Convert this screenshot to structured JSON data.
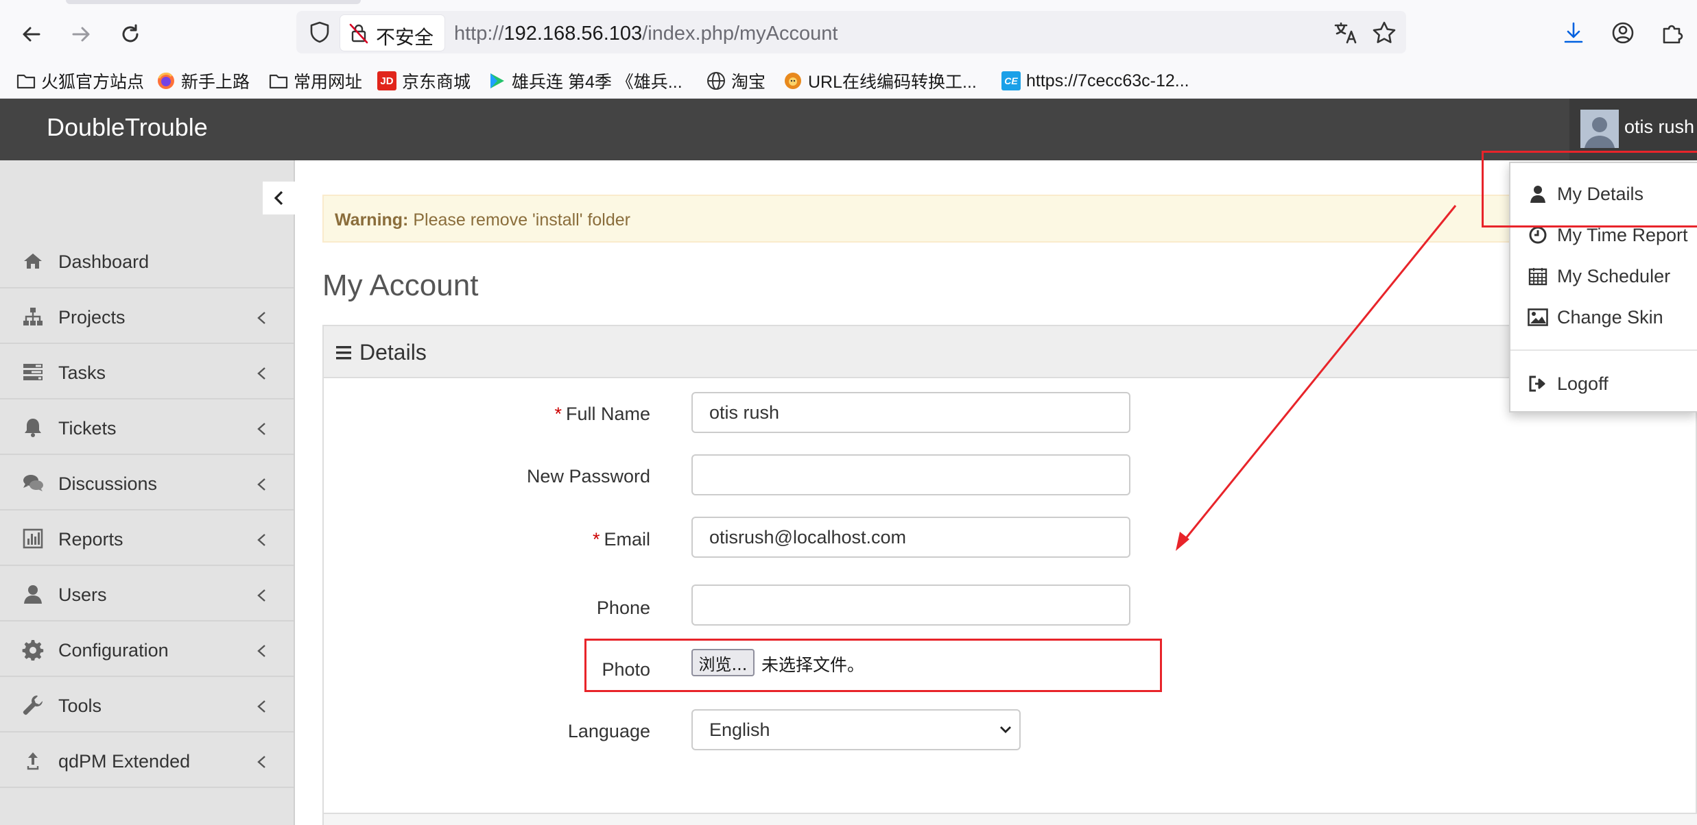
{
  "browser": {
    "security_label": "不安全",
    "url_scheme": "http://",
    "url_host": "192.168.56.103",
    "url_path": "/index.php/myAccount",
    "bookmarks": [
      {
        "label": "火狐官方站点",
        "icon": "folder-icon"
      },
      {
        "label": "新手上路",
        "icon": "firefox-icon"
      },
      {
        "label": "常用网址",
        "icon": "folder-icon"
      },
      {
        "label": "京东商城",
        "icon": "jd-icon"
      },
      {
        "label": "雄兵连 第4季 《雄兵...",
        "icon": "video-icon"
      },
      {
        "label": "淘宝",
        "icon": "globe-icon"
      },
      {
        "label": "URL在线编码转换工...",
        "icon": "lion-icon"
      },
      {
        "label": "https://7cecc63c-12...",
        "icon": "ce-icon"
      }
    ],
    "jd_icon_text": "JD",
    "ce_icon_text": "CE"
  },
  "app": {
    "brand": "DoubleTrouble",
    "user_name": "otis rush"
  },
  "sidebar": {
    "items": [
      {
        "label": "Dashboard",
        "icon": "home-icon",
        "has_submenu": false
      },
      {
        "label": "Projects",
        "icon": "sitemap-icon",
        "has_submenu": true
      },
      {
        "label": "Tasks",
        "icon": "tasks-icon",
        "has_submenu": true
      },
      {
        "label": "Tickets",
        "icon": "bell-icon",
        "has_submenu": true
      },
      {
        "label": "Discussions",
        "icon": "comments-icon",
        "has_submenu": true
      },
      {
        "label": "Reports",
        "icon": "bar-chart-icon",
        "has_submenu": true
      },
      {
        "label": "Users",
        "icon": "user-icon",
        "has_submenu": true
      },
      {
        "label": "Configuration",
        "icon": "gear-icon",
        "has_submenu": true
      },
      {
        "label": "Tools",
        "icon": "wrench-icon",
        "has_submenu": true
      },
      {
        "label": "qdPM Extended",
        "icon": "upload-icon",
        "has_submenu": true
      }
    ]
  },
  "main": {
    "warning_strong": "Warning:",
    "warning_text": "Please remove 'install' folder",
    "page_title": "My Account",
    "panel_title": "Details",
    "form": {
      "full_name_label": "Full Name",
      "full_name_value": "otis rush",
      "new_password_label": "New Password",
      "new_password_value": "",
      "email_label": "Email",
      "email_value": "otisrush@localhost.com",
      "phone_label": "Phone",
      "phone_value": "",
      "photo_label": "Photo",
      "photo_browse_label": "浏览...",
      "photo_status": "未选择文件。",
      "language_label": "Language",
      "language_value": "English",
      "required_mark": "*"
    }
  },
  "user_dropdown": {
    "items": [
      {
        "label": "My Details",
        "icon": "user-icon"
      },
      {
        "label": "My Time Report",
        "icon": "clock-icon"
      },
      {
        "label": "My Scheduler",
        "icon": "calendar-icon"
      },
      {
        "label": "Change Skin",
        "icon": "picture-icon"
      },
      {
        "label": "Logoff",
        "icon": "sign-out-icon"
      }
    ]
  },
  "colors": {
    "header_bg": "#444444",
    "sidebar_bg": "#e3e3e3",
    "warning_bg": "#fcf8e3",
    "warning_text": "#8a6d3b",
    "annotation_red": "#e8242a",
    "required_red": "#cc0000"
  }
}
